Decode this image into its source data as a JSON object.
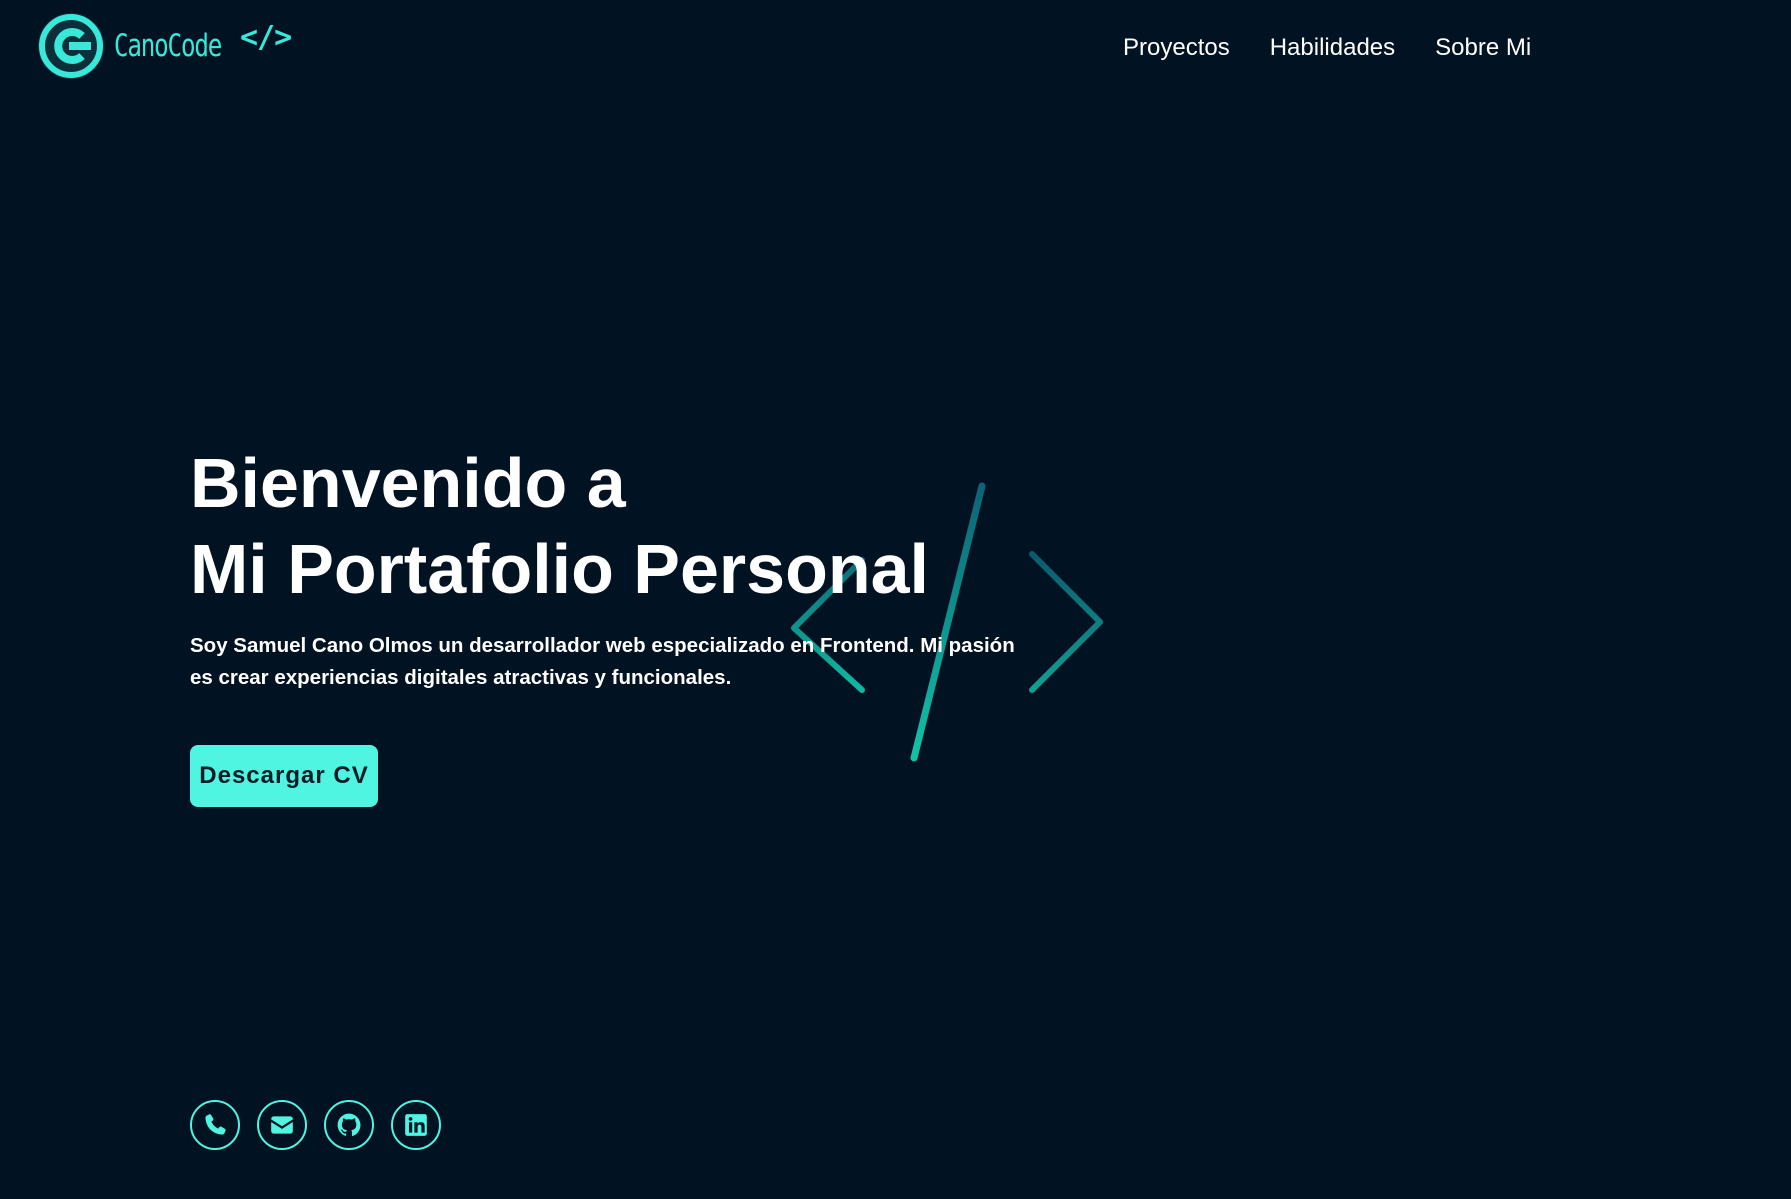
{
  "brand": {
    "name": "CanoCode",
    "tag": "</>",
    "accent_color": "#4ff5e0",
    "background_color": "#011222"
  },
  "nav": {
    "items": [
      {
        "label": "Proyectos"
      },
      {
        "label": "Habilidades"
      },
      {
        "label": "Sobre Mi"
      }
    ]
  },
  "hero": {
    "title_line1": "Bienvenido a",
    "title_line2": "Mi Portafolio Personal",
    "description": "Soy Samuel Cano Olmos un desarrollador web especializado en Frontend. Mi pasión es crear experiencias digitales atractivas y funcionales.",
    "cv_button": "Descargar CV"
  },
  "socials": [
    {
      "icon": "phone-icon"
    },
    {
      "icon": "envelope-icon"
    },
    {
      "icon": "github-icon"
    },
    {
      "icon": "linkedin-icon"
    }
  ]
}
